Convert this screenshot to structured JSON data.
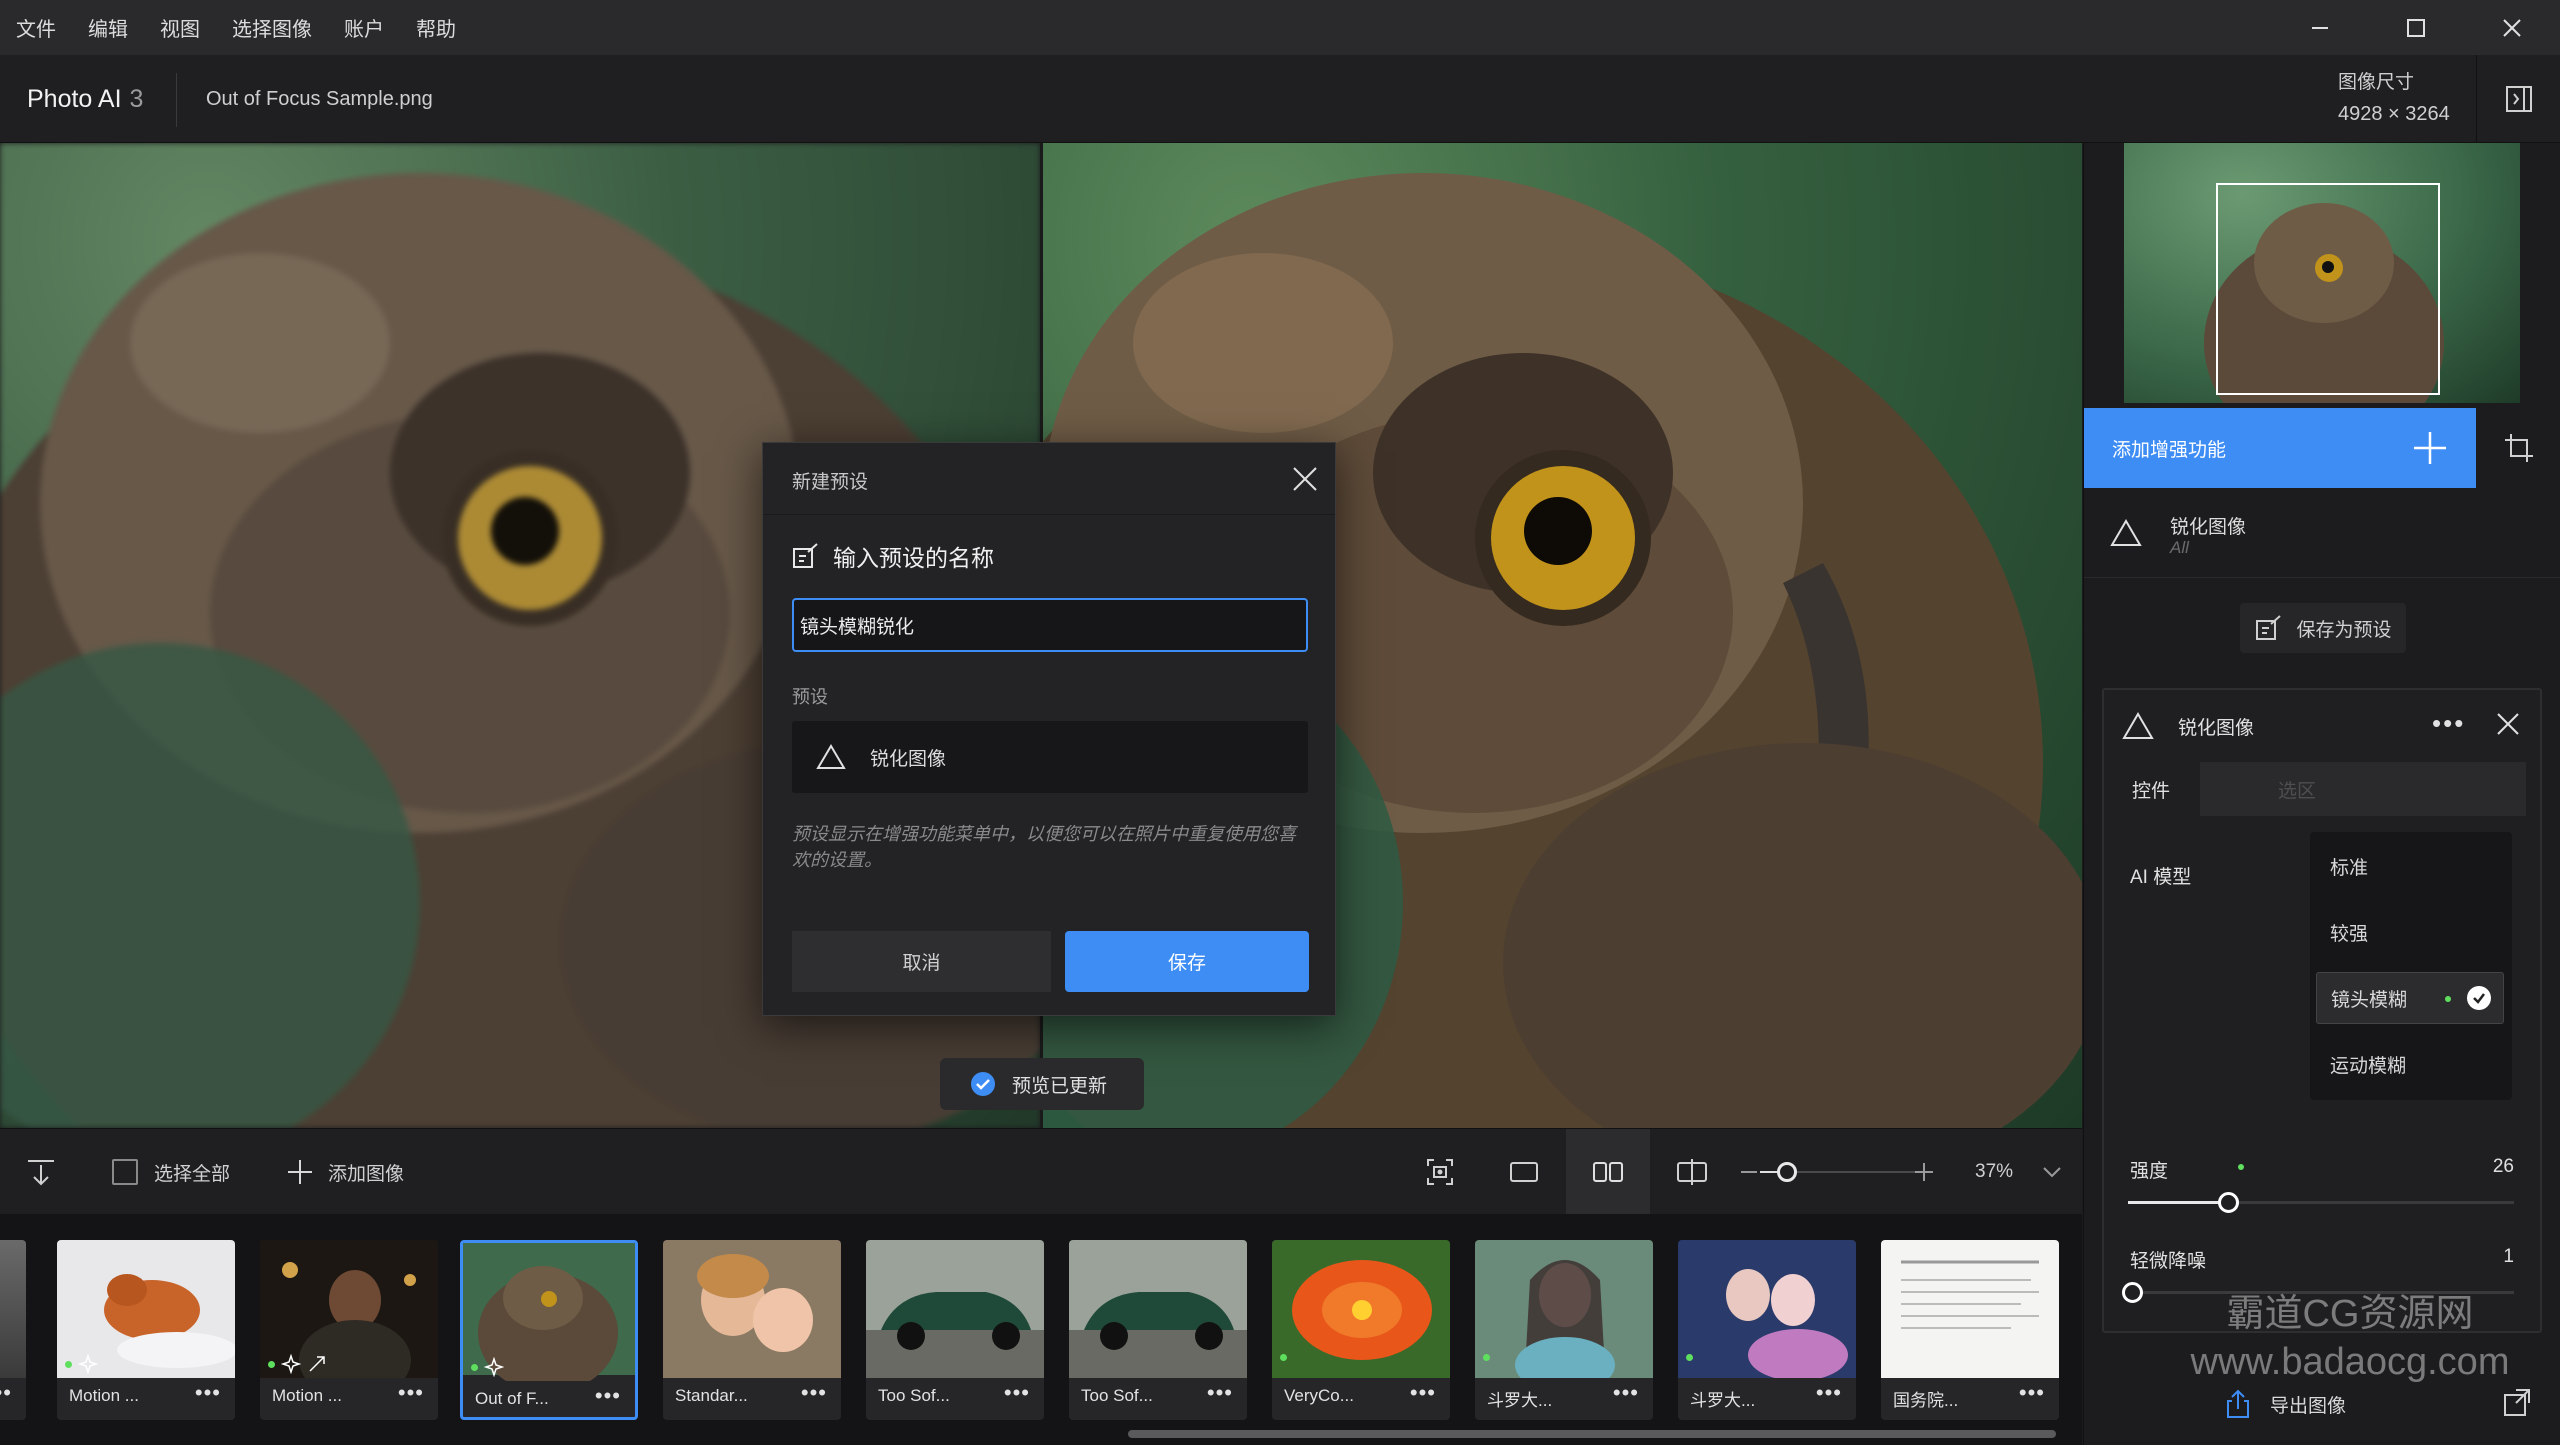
{
  "menubar": {
    "items": [
      "文件",
      "编辑",
      "视图",
      "选择图像",
      "账户",
      "帮助"
    ]
  },
  "header": {
    "app_name": "Photo AI",
    "app_version": "3",
    "filename": "Out of Focus Sample.png",
    "dimension_label": "图像尺寸",
    "dimension_value": "4928 × 3264"
  },
  "dialog": {
    "title": "新建预设",
    "heading": "输入预设的名称",
    "name_value": "镜头模糊锐化",
    "preset_label": "预设",
    "preset_item": "锐化图像",
    "hint": "预设显示在增强功能菜单中，以便您可以在照片中重复使用您喜欢的设置。",
    "cancel_label": "取消",
    "save_label": "保存"
  },
  "toast": {
    "text": "预览已更新"
  },
  "toolbar": {
    "select_all": "选择全部",
    "add_image": "添加图像",
    "zoom_text": "37%",
    "zoom_level": 0.37
  },
  "filmstrip": {
    "items": [
      {
        "label": "Motion ...",
        "selected": false
      },
      {
        "label": "Motion ...",
        "selected": false
      },
      {
        "label": "Out of F...",
        "selected": true
      },
      {
        "label": "Standar...",
        "selected": false
      },
      {
        "label": "Too Sof...",
        "selected": false
      },
      {
        "label": "Too Sof...",
        "selected": false
      },
      {
        "label": "VeryCo...",
        "selected": false
      },
      {
        "label": "斗罗大...",
        "selected": false
      },
      {
        "label": "斗罗大...",
        "selected": false
      },
      {
        "label": "国务院...",
        "selected": false
      }
    ],
    "more_glyph": "•••"
  },
  "rpanel": {
    "add_enhancement": "添加增强功能",
    "enhancement_name": "锐化图像",
    "enhancement_sub": "All",
    "save_preset": "保存为预设",
    "card": {
      "title": "锐化图像",
      "more_glyph": "•••",
      "tab_controls": "控件",
      "tab_selection": "选区",
      "ai_model_label": "AI 模型",
      "models": [
        {
          "label": "标准",
          "selected": false
        },
        {
          "label": "较强",
          "selected": false
        },
        {
          "label": "镜头模糊",
          "selected": true
        },
        {
          "label": "运动模糊",
          "selected": false
        }
      ],
      "strength_label": "强度",
      "strength_value": "26",
      "strength_level": 0.26,
      "denoise_label": "轻微降噪",
      "denoise_value": "1",
      "denoise_level": 0.01
    },
    "export_label": "导出图像"
  },
  "watermark": {
    "line1": "霸道CG资源网",
    "line2": "www.badaocg.com"
  },
  "colors": {
    "accent": "#3d8df5",
    "background": "#1c1c1e",
    "status_green": "#5ee05e"
  }
}
